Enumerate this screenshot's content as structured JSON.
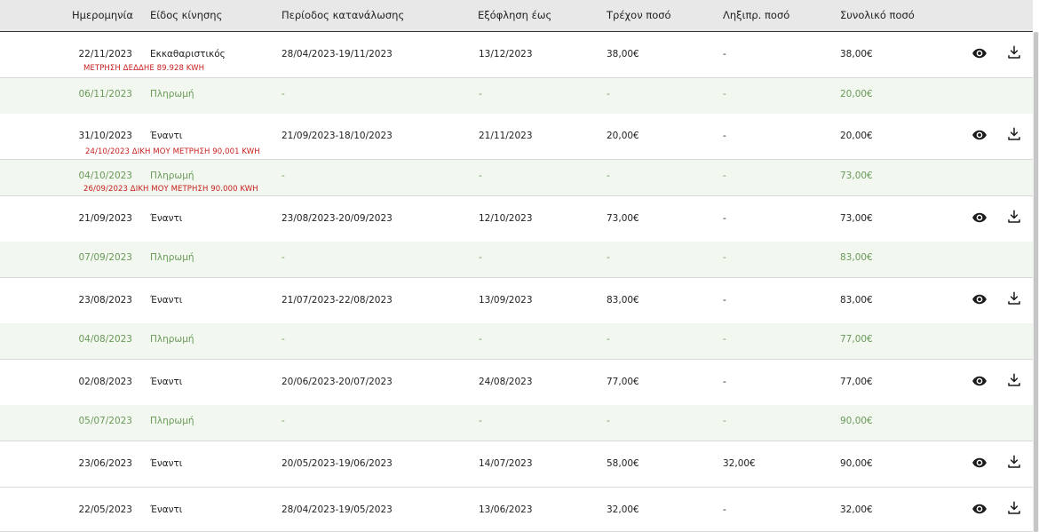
{
  "headers": {
    "date": "Ημερομηνία",
    "type": "Είδος κίνησης",
    "period": "Περίοδος κατανάλωσης",
    "due": "Εξόφληση έως",
    "current": "Τρέχον ποσό",
    "overdue": "Ληξιπρ. ποσό",
    "total": "Συνολικό ποσό"
  },
  "rows": [
    {
      "kind": "tx",
      "date": "22/11/2023",
      "type": "Εκκαθαριστικός",
      "period": "28/04/2023-19/11/2023",
      "due": "13/12/2023",
      "current": "38,00€",
      "overdue": "-",
      "total": "38,00€"
    },
    {
      "kind": "pay",
      "date": "06/11/2023",
      "type": "Πληρωμή",
      "period": "-",
      "due": "-",
      "current": "-",
      "overdue": "-",
      "total": "20,00€"
    },
    {
      "kind": "tx",
      "date": "31/10/2023",
      "type": "Έναντι",
      "period": "21/09/2023-18/10/2023",
      "due": "21/11/2023",
      "current": "20,00€",
      "overdue": "-",
      "total": "20,00€"
    },
    {
      "kind": "pay",
      "date": "04/10/2023",
      "type": "Πληρωμή",
      "period": "-",
      "due": "-",
      "current": "-",
      "overdue": "-",
      "total": "73,00€"
    },
    {
      "kind": "tx",
      "date": "21/09/2023",
      "type": "Έναντι",
      "period": "23/08/2023-20/09/2023",
      "due": "12/10/2023",
      "current": "73,00€",
      "overdue": "-",
      "total": "73,00€"
    },
    {
      "kind": "pay",
      "date": "07/09/2023",
      "type": "Πληρωμή",
      "period": "-",
      "due": "-",
      "current": "-",
      "overdue": "-",
      "total": "83,00€"
    },
    {
      "kind": "tx",
      "date": "23/08/2023",
      "type": "Έναντι",
      "period": "21/07/2023-22/08/2023",
      "due": "13/09/2023",
      "current": "83,00€",
      "overdue": "-",
      "total": "83,00€"
    },
    {
      "kind": "pay",
      "date": "04/08/2023",
      "type": "Πληρωμή",
      "period": "-",
      "due": "-",
      "current": "-",
      "overdue": "-",
      "total": "77,00€"
    },
    {
      "kind": "tx",
      "date": "02/08/2023",
      "type": "Έναντι",
      "period": "20/06/2023-20/07/2023",
      "due": "24/08/2023",
      "current": "77,00€",
      "overdue": "-",
      "total": "77,00€"
    },
    {
      "kind": "pay",
      "date": "05/07/2023",
      "type": "Πληρωμή",
      "period": "-",
      "due": "-",
      "current": "-",
      "overdue": "-",
      "total": "90,00€"
    },
    {
      "kind": "tx",
      "date": "23/06/2023",
      "type": "Έναντι",
      "period": "20/05/2023-19/06/2023",
      "due": "14/07/2023",
      "current": "58,00€",
      "overdue": "32,00€",
      "total": "90,00€"
    },
    {
      "kind": "tx",
      "date": "22/05/2023",
      "type": "Έναντι",
      "period": "28/04/2023-19/05/2023",
      "due": "13/06/2023",
      "current": "32,00€",
      "overdue": "-",
      "total": "32,00€"
    }
  ],
  "notes": [
    "ΜΕΤΡΗΣΗ ΔΕΔΔΗΕ 89.928 KWH",
    "24/10/2023 ΔΙΚΗ ΜΟΥ ΜΕΤΡΗΣΗ 90,001 KWH",
    "26/09/2023 ΔΙΚΗ ΜΟΥ ΜΕΤΡΗΣΗ 90.000  KWH"
  ],
  "icons": {
    "view": "eye-icon",
    "download": "download-icon"
  },
  "colors": {
    "payment_text": "#6a9a5a",
    "note_text": "#c8201f",
    "payment_row_bg": "#f2f7ef",
    "header_bg": "#e8e8e8"
  }
}
